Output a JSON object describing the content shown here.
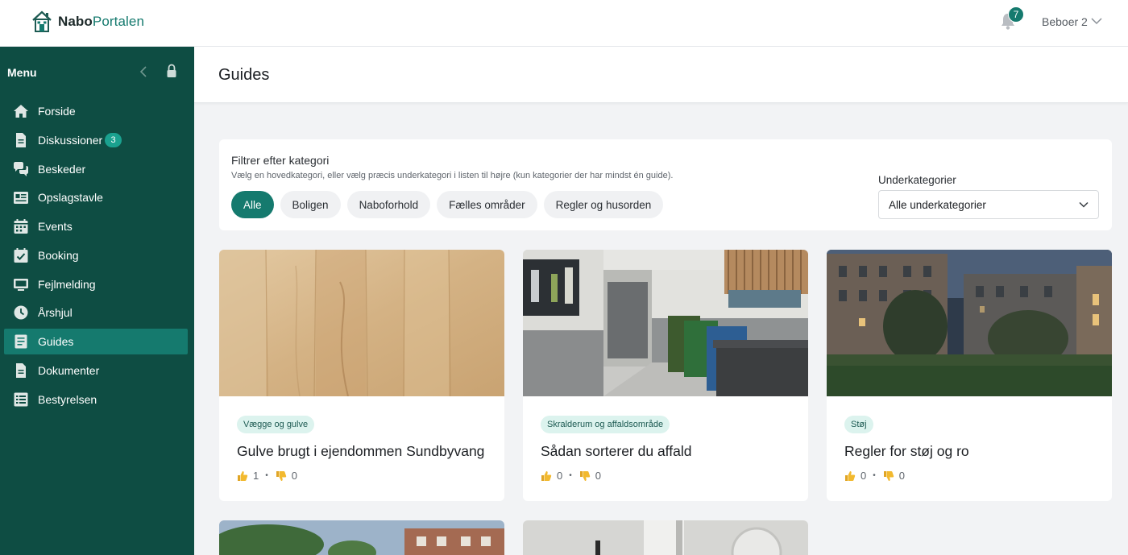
{
  "brand": {
    "name_bold": "Nabo",
    "name_light": "Portalen"
  },
  "topbar": {
    "notification_count": "7",
    "user_name": "Beboer 2"
  },
  "sidebar": {
    "menu_title": "Menu",
    "items": [
      {
        "label": "Forside",
        "icon": "home-icon"
      },
      {
        "label": "Diskussioner",
        "icon": "document-icon",
        "badge": "3"
      },
      {
        "label": "Beskeder",
        "icon": "chat-icon"
      },
      {
        "label": "Opslagstavle",
        "icon": "board-icon"
      },
      {
        "label": "Events",
        "icon": "calendar-icon"
      },
      {
        "label": "Booking",
        "icon": "calendar-check-icon"
      },
      {
        "label": "Fejlmelding",
        "icon": "monitor-icon"
      },
      {
        "label": "Årshjul",
        "icon": "clock-icon"
      },
      {
        "label": "Guides",
        "icon": "guide-icon",
        "active": true
      },
      {
        "label": "Dokumenter",
        "icon": "document-icon"
      },
      {
        "label": "Bestyrelsen",
        "icon": "list-icon"
      }
    ]
  },
  "page": {
    "title": "Guides"
  },
  "filter": {
    "title": "Filtrer efter kategori",
    "description": "Vælg en hovedkategori, eller vælg præcis underkategori i listen til højre (kun kategorier der har mindst én guide).",
    "categories": [
      "Alle",
      "Boligen",
      "Naboforhold",
      "Fælles områder",
      "Regler og husorden"
    ],
    "active_category": "Alle",
    "subcategory_label": "Underkategorier",
    "subcategory_value": "Alle underkategorier"
  },
  "guides": [
    {
      "tag": "Vægge og gulve",
      "title": "Gulve brugt i ejendommen Sundbyvang",
      "likes": "1",
      "dislikes": "0",
      "image": "wood-floor"
    },
    {
      "tag": "Skralderum og affaldsområde",
      "title": "Sådan sorterer du affald",
      "likes": "0",
      "dislikes": "0",
      "image": "waste-room"
    },
    {
      "tag": "Støj",
      "title": "Regler for støj og ro",
      "likes": "0",
      "dislikes": "0",
      "image": "courtyard-evening"
    }
  ],
  "colors": {
    "sidebar": "#0e4d43",
    "accent": "#157a6e",
    "tag_bg": "#dcf3ee"
  }
}
